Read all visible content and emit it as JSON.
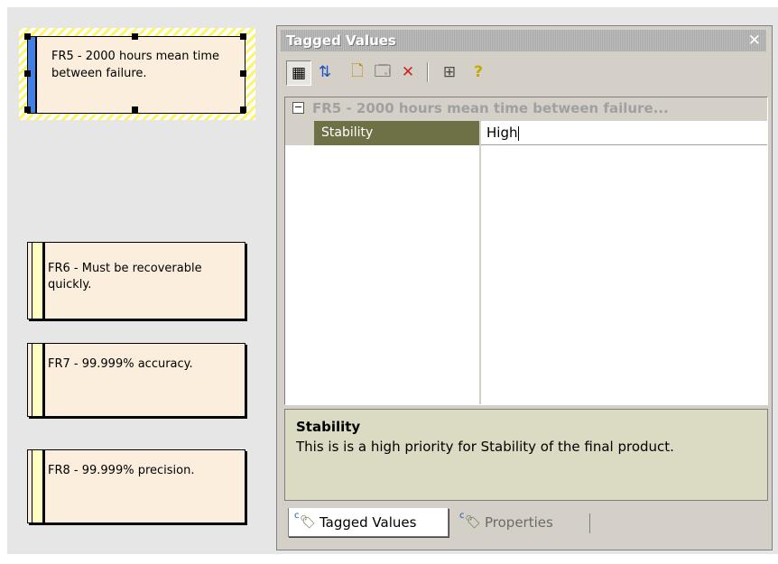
{
  "notes": [
    {
      "id": "FR5",
      "text": "FR5 - 2000 hours mean time between failure."
    },
    {
      "id": "FR6",
      "text": "FR6 - Must be recoverable quickly."
    },
    {
      "id": "FR7",
      "text": "FR7 - 99.999% accuracy."
    },
    {
      "id": "FR8",
      "text": "FR8 - 99.999% precision."
    }
  ],
  "panel": {
    "title": "Tagged Values",
    "close_icon": "✕",
    "toolbar": [
      {
        "name": "categorized-view-icon",
        "glyph": "▦"
      },
      {
        "name": "sort-alphabetic-icon",
        "glyph": "⇅"
      },
      {
        "name": "new-tag-icon",
        "glyph": "🗋"
      },
      {
        "name": "properties-icon",
        "glyph": "🗔"
      },
      {
        "name": "delete-icon",
        "glyph": "✕"
      },
      {
        "name": "tag-library-icon",
        "glyph": "⊞"
      },
      {
        "name": "help-icon",
        "glyph": "?"
      }
    ],
    "group": {
      "toggle": "−",
      "label": "FR5 - 2000 hours mean time between failure..."
    },
    "property": {
      "name": "Stability",
      "value": "High"
    },
    "description": {
      "title": "Stability",
      "text": "This is is a high priority for Stability of the final product."
    },
    "tabs": [
      {
        "label": "Tagged Values",
        "active": true
      },
      {
        "label": "Properties",
        "active": false
      }
    ]
  },
  "colors": {
    "note_fill": "#fbeedd",
    "note_bar": "#ffffc0",
    "selected_bar": "#3f7fe6",
    "property_highlight": "#6e7046",
    "description_fill": "#dbdbc3"
  }
}
